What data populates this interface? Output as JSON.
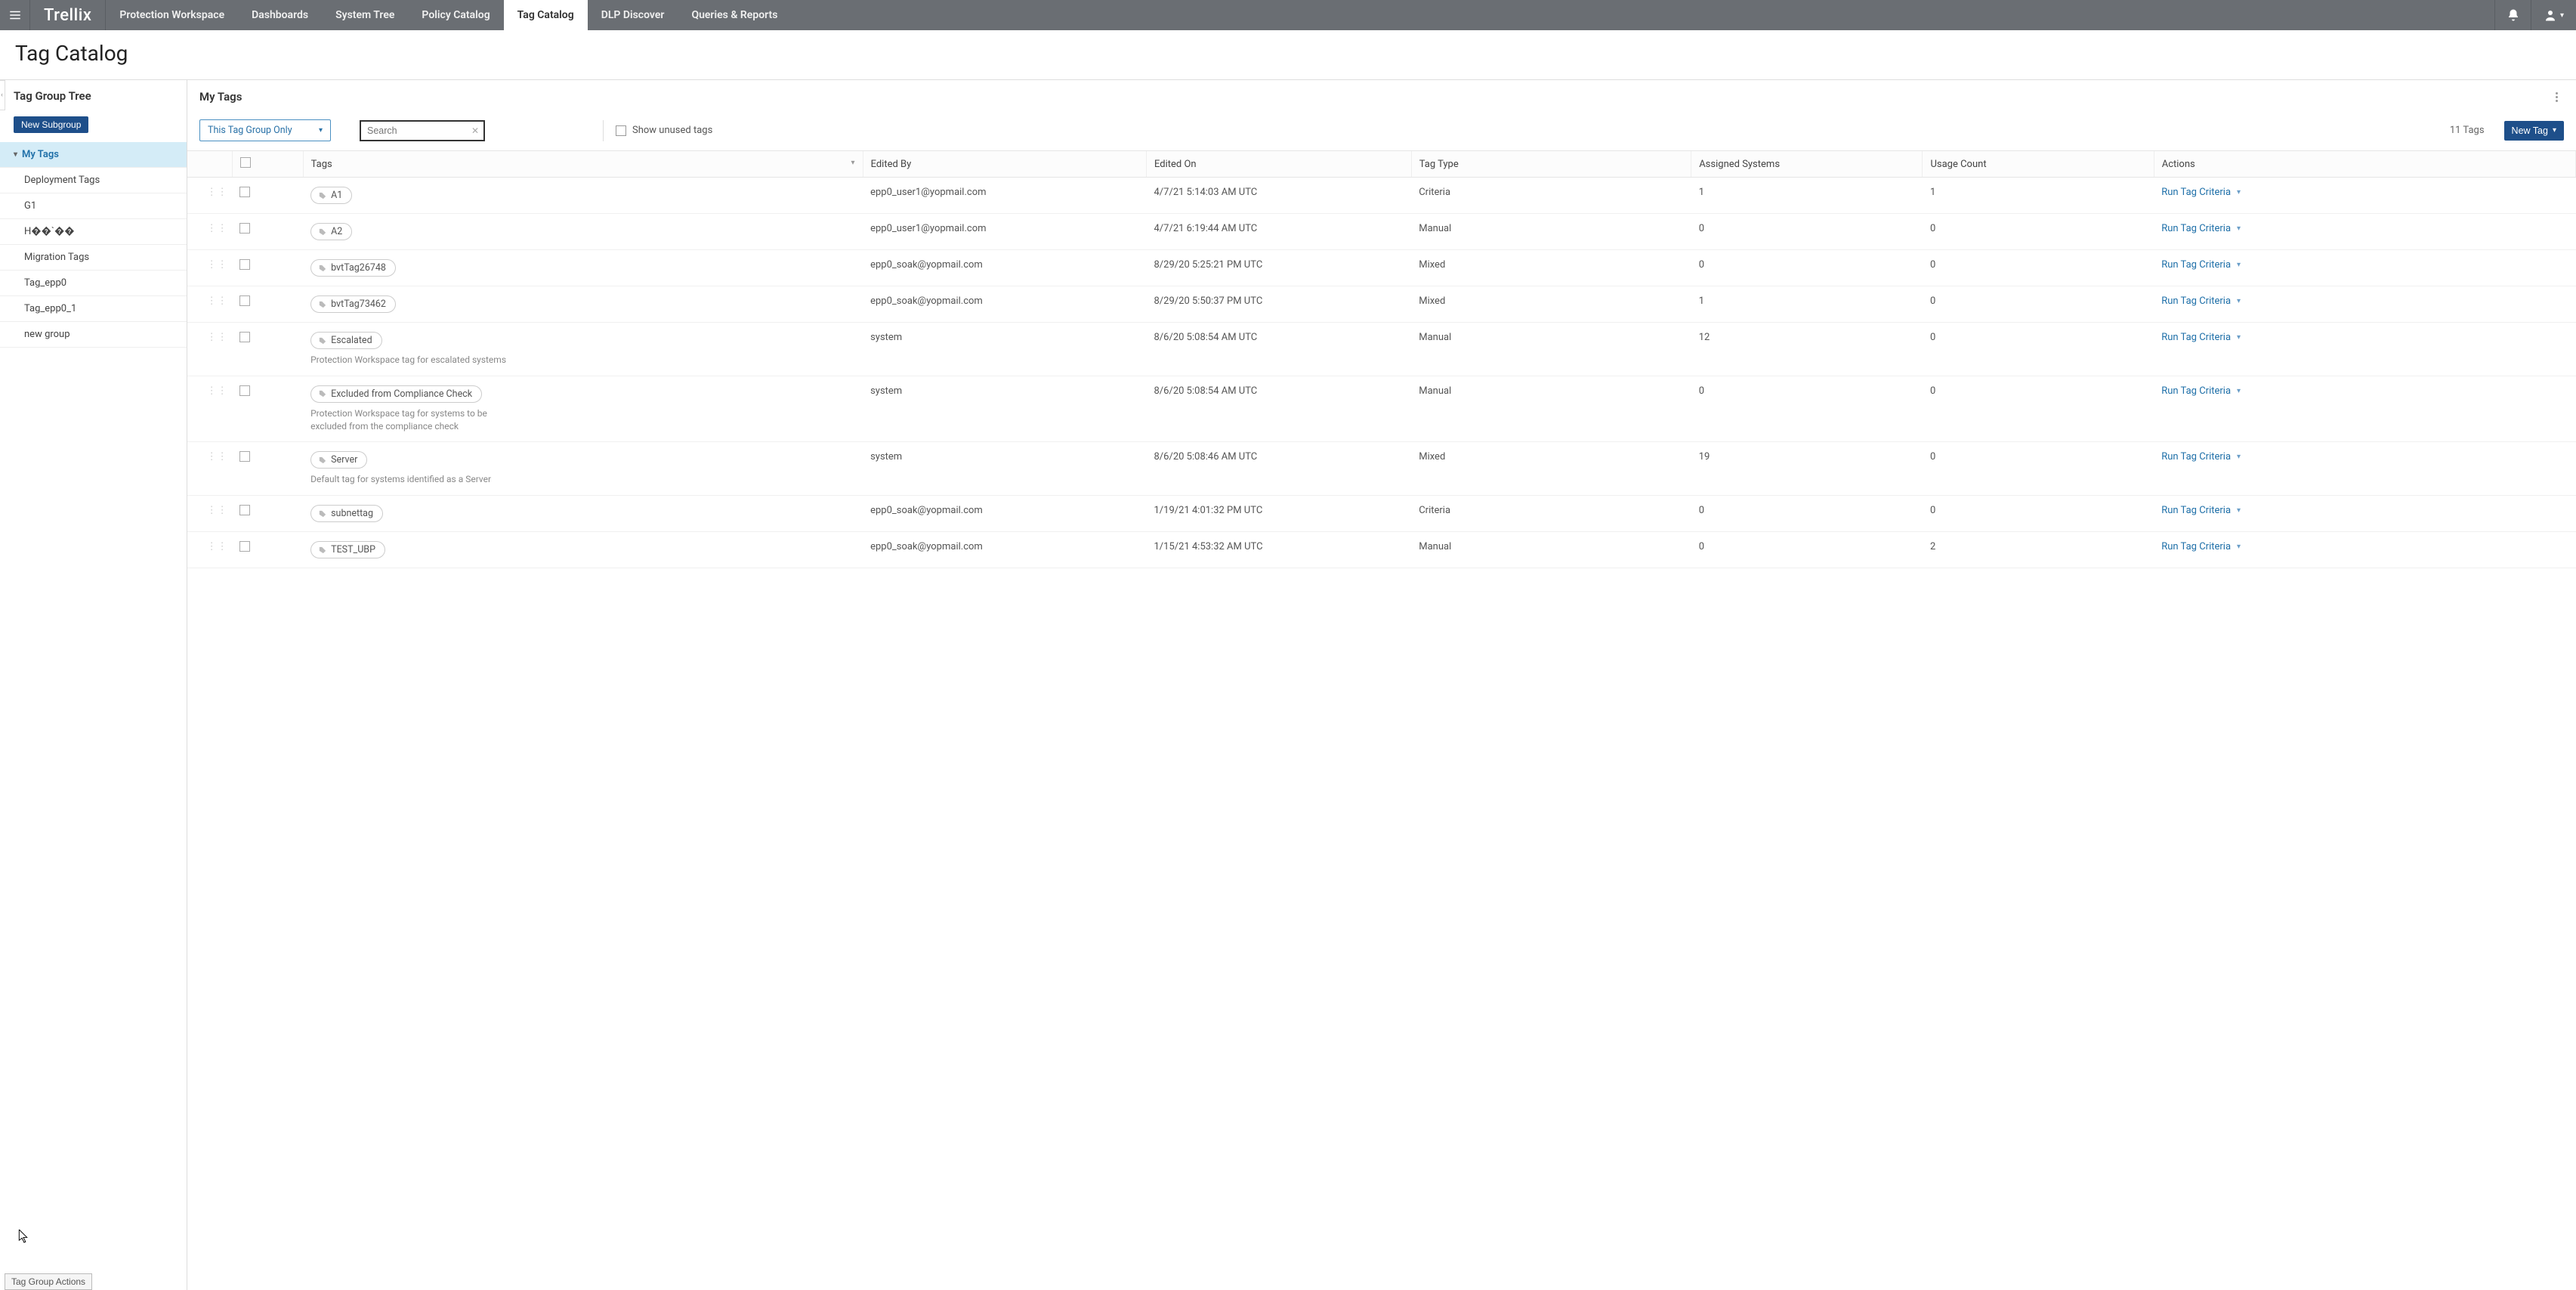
{
  "topbar": {
    "logo": "Trellix",
    "tabs": [
      {
        "label": "Protection Workspace",
        "active": false
      },
      {
        "label": "Dashboards",
        "active": false
      },
      {
        "label": "System Tree",
        "active": false
      },
      {
        "label": "Policy Catalog",
        "active": false
      },
      {
        "label": "Tag Catalog",
        "active": true
      },
      {
        "label": "DLP Discover",
        "active": false
      },
      {
        "label": "Queries & Reports",
        "active": false
      }
    ]
  },
  "page_title": "Tag Catalog",
  "sidebar": {
    "header": "Tag Group Tree",
    "new_subgroup_label": "New Subgroup",
    "root_label": "My Tags",
    "children": [
      "Deployment Tags",
      "G1",
      "H��`��",
      "Migration Tags",
      "Tag_epp0",
      "Tag_epp0_1",
      "new group"
    ],
    "bottom_button": "Tag Group Actions"
  },
  "main": {
    "title": "My Tags",
    "scope_selected": "This Tag Group Only",
    "search_placeholder": "Search",
    "show_unused_label": "Show unused tags",
    "tag_count_text": "11 Tags",
    "new_tag_label": "New Tag",
    "columns": {
      "tags": "Tags",
      "edited_by": "Edited By",
      "edited_on": "Edited On",
      "tag_type": "Tag Type",
      "assigned_systems": "Assigned Systems",
      "usage_count": "Usage Count",
      "actions": "Actions"
    },
    "action_label": "Run Tag Criteria",
    "rows": [
      {
        "tag": "A1",
        "desc": "",
        "edited_by": "epp0_user1@yopmail.com",
        "edited_on": "4/7/21 5:14:03 AM UTC",
        "tag_type": "Criteria",
        "assigned": "1",
        "usage": "1"
      },
      {
        "tag": "A2",
        "desc": "",
        "edited_by": "epp0_user1@yopmail.com",
        "edited_on": "4/7/21 6:19:44 AM UTC",
        "tag_type": "Manual",
        "assigned": "0",
        "usage": "0"
      },
      {
        "tag": "bvtTag26748",
        "desc": "",
        "edited_by": "epp0_soak@yopmail.com",
        "edited_on": "8/29/20 5:25:21 PM UTC",
        "tag_type": "Mixed",
        "assigned": "0",
        "usage": "0"
      },
      {
        "tag": "bvtTag73462",
        "desc": "",
        "edited_by": "epp0_soak@yopmail.com",
        "edited_on": "8/29/20 5:50:37 PM UTC",
        "tag_type": "Mixed",
        "assigned": "1",
        "usage": "0"
      },
      {
        "tag": "Escalated",
        "desc": "Protection Workspace tag for escalated systems",
        "edited_by": "system",
        "edited_on": "8/6/20 5:08:54 AM UTC",
        "tag_type": "Manual",
        "assigned": "12",
        "usage": "0"
      },
      {
        "tag": "Excluded from Compliance Check",
        "desc": "Protection Workspace tag for systems to be excluded from the compliance check",
        "edited_by": "system",
        "edited_on": "8/6/20 5:08:54 AM UTC",
        "tag_type": "Manual",
        "assigned": "0",
        "usage": "0"
      },
      {
        "tag": "Server",
        "desc": "Default tag for systems identified as a Server",
        "edited_by": "system",
        "edited_on": "8/6/20 5:08:46 AM UTC",
        "tag_type": "Mixed",
        "assigned": "19",
        "usage": "0"
      },
      {
        "tag": "subnettag",
        "desc": "",
        "edited_by": "epp0_soak@yopmail.com",
        "edited_on": "1/19/21 4:01:32 PM UTC",
        "tag_type": "Criteria",
        "assigned": "0",
        "usage": "0"
      },
      {
        "tag": "TEST_UBP",
        "desc": "",
        "edited_by": "epp0_soak@yopmail.com",
        "edited_on": "1/15/21 4:53:32 AM UTC",
        "tag_type": "Manual",
        "assigned": "0",
        "usage": "2"
      }
    ]
  }
}
